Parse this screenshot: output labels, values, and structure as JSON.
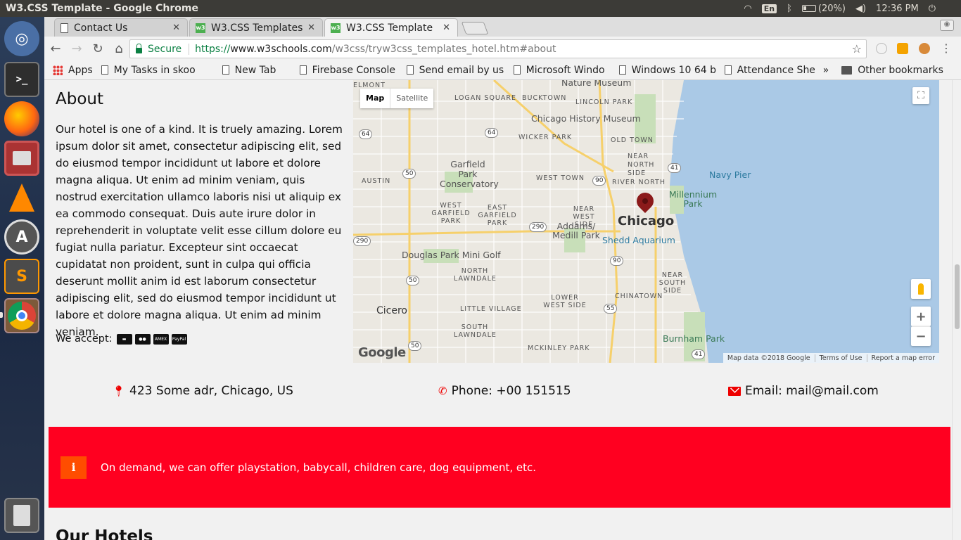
{
  "os": {
    "window_title": "W3.CSS Template - Google Chrome",
    "keyboard": "En",
    "battery": "(20%)",
    "clock": "12:36 PM"
  },
  "launcher": {
    "items": [
      "ubuntu-icon",
      "terminal-icon",
      "firefox-icon",
      "files-icon",
      "vlc-icon",
      "software-updater-icon",
      "sublime-text-icon",
      "chrome-icon",
      "trash-icon"
    ]
  },
  "tabs": [
    {
      "label": "Contact Us",
      "favicon": "document-icon"
    },
    {
      "label": "W3.CSS Templates",
      "favicon": "w3-icon"
    },
    {
      "label": "W3.CSS Template",
      "favicon": "w3-icon"
    }
  ],
  "toolbar": {
    "secure_label": "Secure",
    "url_scheme": "https://",
    "url_host": "www.w3schools.com",
    "url_path": "/w3css/tryw3css_templates_hotel.htm#about"
  },
  "bookmarks": {
    "apps": "Apps",
    "items": [
      "My Tasks in skoo",
      "New Tab",
      "Firebase Console",
      "Send email by us",
      "Microsoft Windo",
      "Windows 10 64 b",
      "Attendance Shee"
    ],
    "more": "»",
    "other": "Other bookmarks"
  },
  "about": {
    "heading": "About",
    "text": "Our hotel is one of a kind. It is truely amazing. Lorem ipsum dolor sit amet, consectetur adipiscing elit, sed do eiusmod tempor incididunt ut labore et dolore magna aliqua. Ut enim ad minim veniam, quis nostrud exercitation ullamco laboris nisi ut aliquip ex ea commodo consequat. Duis aute irure dolor in reprehenderit in voluptate velit esse cillum dolore eu fugiat nulla pariatur. Excepteur sint occaecat cupidatat non proident, sunt in culpa qui officia deserunt mollit anim id est laborum consectetur adipiscing elit, sed do eiusmod tempor incididunt ut labore et dolore magna aliqua. Ut enim ad minim veniam.",
    "accept_label": "We accept:",
    "cards": [
      "credit-card-icon",
      "mastercard-icon",
      "amex-icon",
      "paypal-icon"
    ],
    "amex_text": "AMEX",
    "paypal_text": "PayPal"
  },
  "map": {
    "map_btn": "Map",
    "satellite_btn": "Satellite",
    "city": "Chicago",
    "labels": {
      "elmont": "ELMONT",
      "nature_museum": "Nature Museum",
      "logan": "LOGAN SQUARE",
      "bucktown": "BUCKTOWN",
      "lincoln": "LINCOLN PARK",
      "history": "Chicago History Museum",
      "wicker": "WICKER PARK",
      "oldtown": "OLD TOWN",
      "garfield": "Garfield Park Conservatory",
      "nearnorth": "NEAR NORTH SIDE",
      "navy": "Navy Pier",
      "austin": "AUSTIN",
      "westtown": "WEST TOWN",
      "river": "RIVER NORTH",
      "millennium": "Millennium Park",
      "wgp": "WEST GARFIELD PARK",
      "egp": "EAST GARFIELD PARK",
      "nearwest": "NEAR WEST SIDE",
      "addams": "Addams/ Medill Park",
      "shedd": "Shedd Aquarium",
      "douglas": "Douglas Park Mini Golf",
      "nlawndale": "NORTH LAWNDALE",
      "nearsouth": "NEAR SOUTH SIDE",
      "cicero": "Cicero",
      "little": "LITTLE VILLAGE",
      "lowerwest": "LOWER WEST SIDE",
      "chinatown": "CHINATOWN",
      "slawndale": "SOUTH LAWNDALE",
      "burnham": "Burnham Park",
      "mckinley": "MCKINLEY PARK"
    },
    "shields": [
      "64",
      "64",
      "50",
      "90",
      "41",
      "290",
      "290",
      "90",
      "50",
      "55",
      "50",
      "41"
    ],
    "google": "Google",
    "footer": [
      "Map data ©2018 Google",
      "Terms of Use",
      "Report a map error"
    ],
    "zoom_in": "+",
    "zoom_out": "−"
  },
  "contact": {
    "address": "423 Some adr, Chicago, US",
    "phone": "Phone: +00 151515",
    "email": "Email: mail@mail.com"
  },
  "notice": {
    "icon": "i",
    "text": "On demand, we can offer playstation, babycall, children care, dog equipment, etc."
  },
  "hotels": {
    "heading": "Our Hotels"
  },
  "colors": {
    "notice_bg": "#ff0020",
    "notice_icon_bg": "#ff4d00",
    "accent_red": "#e00000",
    "secure_green": "#0b8043"
  }
}
